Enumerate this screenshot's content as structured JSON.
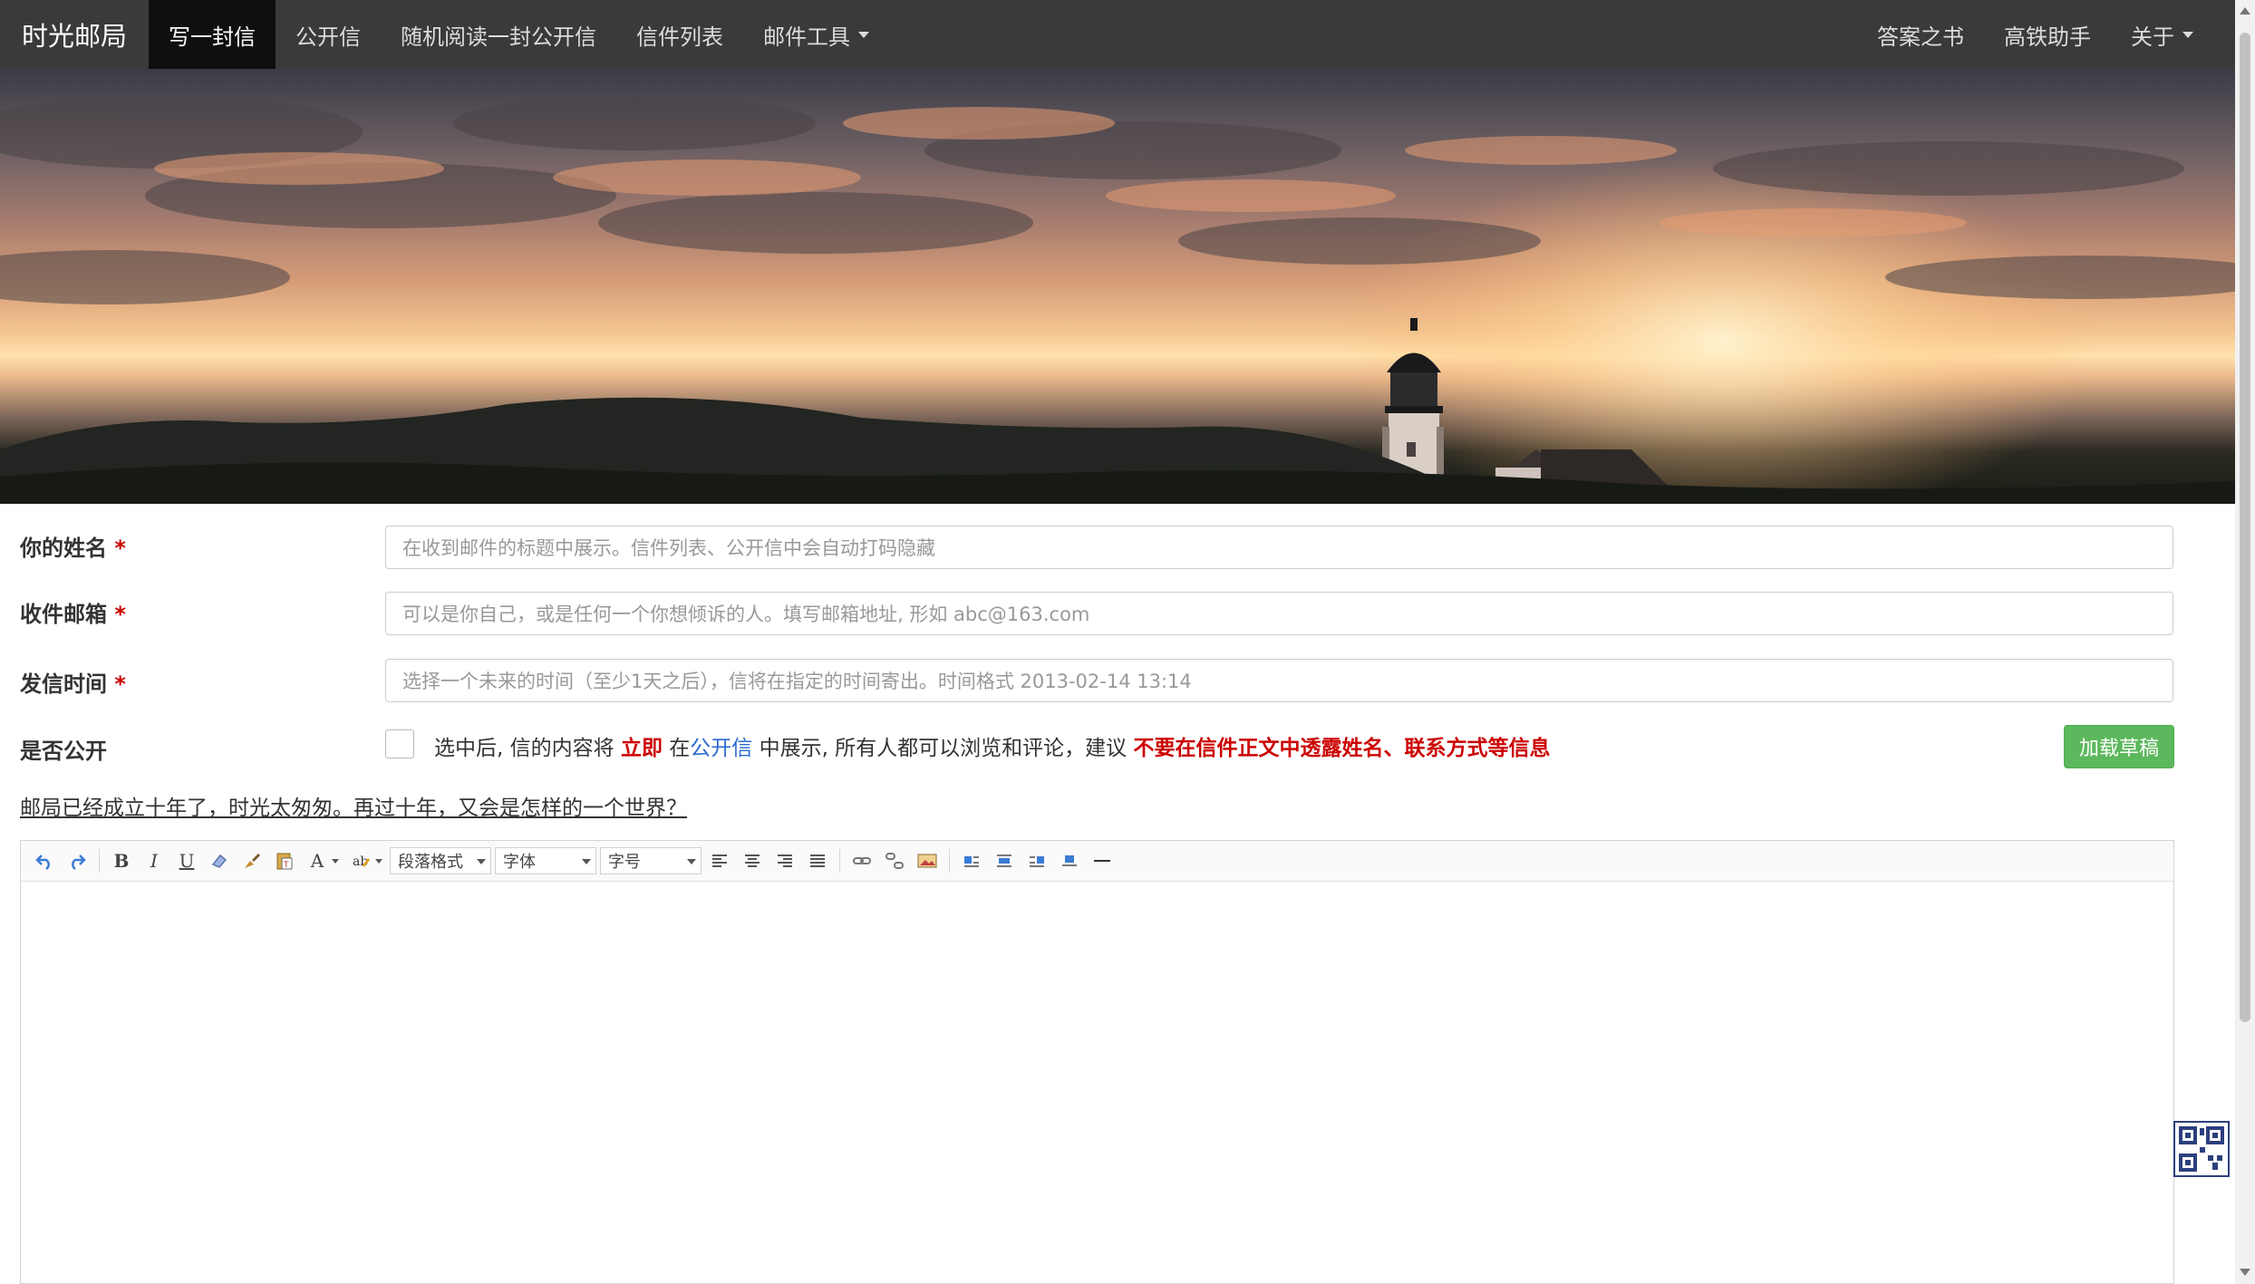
{
  "nav": {
    "brand": "时光邮局",
    "items": [
      "写一封信",
      "公开信",
      "随机阅读一封公开信",
      "信件列表",
      "邮件工具"
    ],
    "right_items": [
      "答案之书",
      "高铁助手",
      "关于"
    ]
  },
  "form": {
    "name_label": "你的姓名",
    "name_placeholder": "在收到邮件的标题中展示。信件列表、公开信中会自动打码隐藏",
    "email_label": "收件邮箱",
    "email_placeholder": "可以是你自己，或是任何一个你想倾诉的人。填写邮箱地址, 形如 abc@163.com",
    "time_label": "发信时间",
    "time_placeholder": "选择一个未来的时间（至少1天之后），信将在指定的时间寄出。时间格式 2013-02-14 13:14",
    "required_mark": "*",
    "public_label": "是否公开",
    "public_text_1": "选中后, 信的内容将",
    "public_text_strong": "立即",
    "public_text_2": "在",
    "public_text_link": "公开信",
    "public_text_3": "中展示, 所有人都可以浏览和评论，建议",
    "public_text_warn": "不要在信件正文中透露姓名、联系方式等信息",
    "draft_button": "加载草稿",
    "notice": "邮局已经成立十年了，时光太匆匆。再过十年，又会是怎样的一个世界？"
  },
  "editor": {
    "paragraph_select": "段落格式",
    "font_select": "字体",
    "size_select": "字号",
    "icons": [
      "undo-icon",
      "redo-icon",
      "bold-icon",
      "italic-icon",
      "underline-icon",
      "eraser-icon",
      "format-brush-icon",
      "paste-text-icon",
      "font-color-icon",
      "highlight-icon",
      "align-left-icon",
      "align-center-icon",
      "align-right-icon",
      "align-justify-icon",
      "link-icon",
      "unlink-icon",
      "image-icon",
      "float-left-icon",
      "float-none-icon",
      "float-right-icon",
      "center-block-icon",
      "horizontal-rule-icon"
    ],
    "bold_glyph": "B",
    "italic_glyph": "I",
    "underline_glyph": "U",
    "color_glyph": "A"
  },
  "colors": {
    "navbar_bg": "#3a3a3a",
    "nav_active_bg": "#0f0f0f",
    "required": "#cc0000",
    "link": "#2a6ad0",
    "draft_button": "#5cb85c",
    "qr_border": "#2c3f7e"
  }
}
